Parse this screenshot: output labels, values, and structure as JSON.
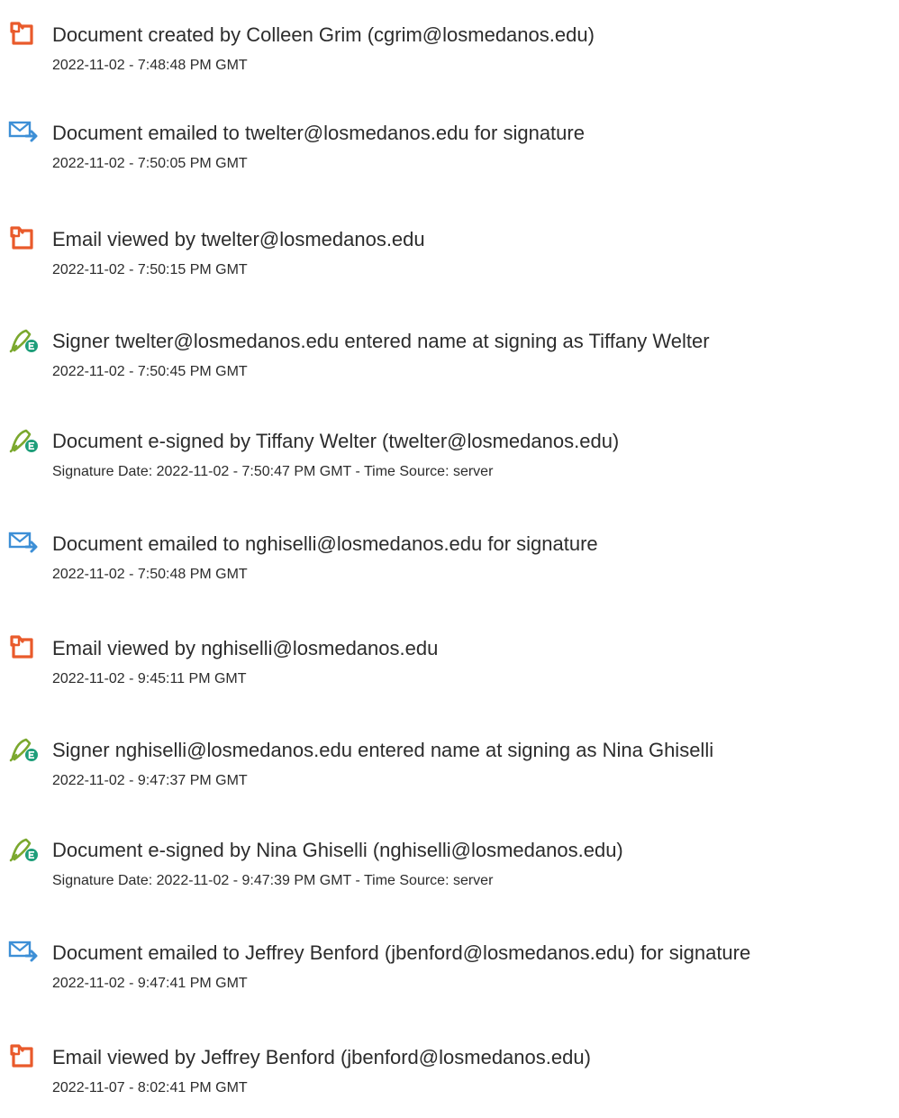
{
  "colors": {
    "doc_icon": "#e95a2b",
    "email_icon": "#3d8fd6",
    "sign_icon": "#7ba82e",
    "sign_badge": "#1f9e7a",
    "text": "#2c2c2c"
  },
  "events": [
    {
      "icon": "document-icon",
      "title": "Document created by Colleen Grim (cgrim@losmedanos.edu)",
      "time": "2022-11-02 - 7:48:48 PM GMT"
    },
    {
      "icon": "email-send-icon",
      "title": "Document emailed to twelter@losmedanos.edu for signature",
      "time": "2022-11-02 - 7:50:05 PM GMT"
    },
    {
      "icon": "document-icon",
      "title": "Email viewed by twelter@losmedanos.edu",
      "time": "2022-11-02 - 7:50:15 PM GMT"
    },
    {
      "icon": "signature-pen-icon",
      "title": "Signer twelter@losmedanos.edu entered name at signing as Tiffany Welter",
      "time": "2022-11-02 - 7:50:45 PM GMT"
    },
    {
      "icon": "signature-pen-icon",
      "title": "Document e-signed by Tiffany Welter (twelter@losmedanos.edu)",
      "time": "Signature Date: 2022-11-02 - 7:50:47 PM GMT - Time Source: server"
    },
    {
      "icon": "email-send-icon",
      "title": "Document emailed to nghiselli@losmedanos.edu for signature",
      "time": "2022-11-02 - 7:50:48 PM GMT"
    },
    {
      "icon": "document-icon",
      "title": "Email viewed by nghiselli@losmedanos.edu",
      "time": "2022-11-02 - 9:45:11 PM GMT"
    },
    {
      "icon": "signature-pen-icon",
      "title": "Signer nghiselli@losmedanos.edu entered name at signing as Nina Ghiselli",
      "time": "2022-11-02 - 9:47:37 PM GMT"
    },
    {
      "icon": "signature-pen-icon",
      "title": "Document e-signed by Nina Ghiselli (nghiselli@losmedanos.edu)",
      "time": "Signature Date: 2022-11-02 - 9:47:39 PM GMT - Time Source: server"
    },
    {
      "icon": "email-send-icon",
      "title": "Document emailed to Jeffrey Benford (jbenford@losmedanos.edu) for signature",
      "time": "2022-11-02 - 9:47:41 PM GMT"
    },
    {
      "icon": "document-icon",
      "title": "Email viewed by Jeffrey Benford (jbenford@losmedanos.edu)",
      "time": "2022-11-07 - 8:02:41 PM GMT"
    }
  ]
}
